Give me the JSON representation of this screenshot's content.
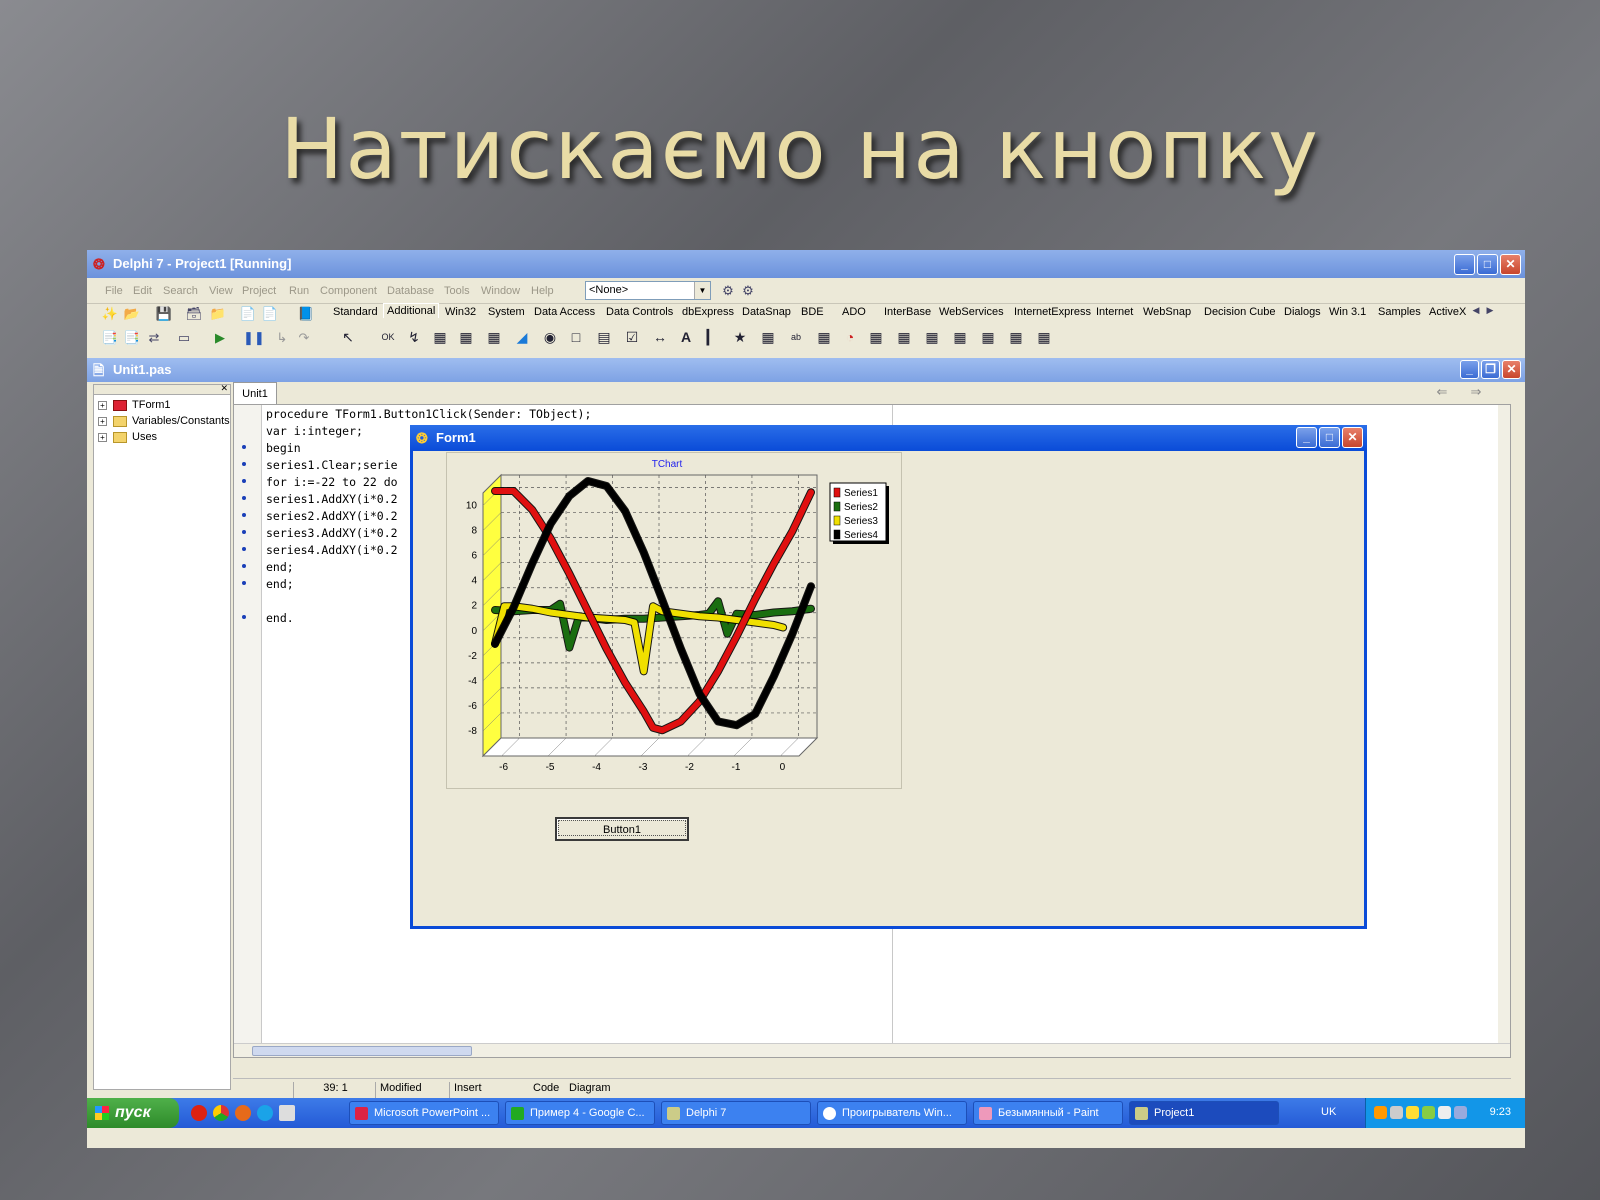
{
  "slide": {
    "title": "Натискаємо на кнопку"
  },
  "ide": {
    "title": "Delphi 7 - Project1 [Running]",
    "menu": [
      "File",
      "Edit",
      "Search",
      "View",
      "Project",
      "Run",
      "Component",
      "Database",
      "Tools",
      "Window",
      "Help"
    ],
    "config_combo": "<None>",
    "palette_tabs": [
      "Standard",
      "Additional",
      "Win32",
      "System",
      "Data Access",
      "Data Controls",
      "dbExpress",
      "DataSnap",
      "BDE",
      "ADO",
      "InterBase",
      "WebServices",
      "InternetExpress",
      "Internet",
      "WebSnap",
      "Decision Cube",
      "Dialogs",
      "Win 3.1",
      "Samples",
      "ActiveX"
    ],
    "active_palette_tab": "Additional"
  },
  "editor": {
    "title": "Unit1.pas",
    "tab": "Unit1",
    "tree": [
      "TForm1",
      "Variables/Constants",
      "Uses"
    ],
    "code": [
      "procedure TForm1.Button1Click(Sender: TObject);",
      "var i:integer;",
      "begin",
      "series1.Clear;serie",
      "for i:=-22 to 22 do",
      "series1.AddXY(i*0.2",
      "series2.AddXY(i*0.2",
      "series3.AddXY(i*0.2",
      "series4.AddXY(i*0.2",
      "end;",
      "end;",
      "",
      "end."
    ],
    "status": {
      "position": "39: 1",
      "modified": "Modified",
      "mode": "Insert",
      "tab_code": "Code",
      "tab_diagram": "Diagram"
    }
  },
  "form1": {
    "title": "Form1",
    "button_label": "Button1"
  },
  "chart_data": {
    "type": "line",
    "title": "TChart",
    "xlabel": "",
    "ylabel": "",
    "xlim": [
      -6.4,
      0.4
    ],
    "ylim": [
      -10,
      11
    ],
    "xticks": [
      "-6",
      "-5",
      "-4",
      "-3",
      "-2",
      "-1",
      "0"
    ],
    "yticks": [
      "10",
      "8",
      "6",
      "4",
      "2",
      "0",
      "-2",
      "-4",
      "-6",
      "-8"
    ],
    "legend_position": "right",
    "grid": true,
    "series": [
      {
        "name": "Series1",
        "color": "#e01010",
        "x": [
          -6.4,
          -6,
          -5.6,
          -5.2,
          -4.8,
          -4.4,
          -4,
          -3.6,
          -3.2,
          -3,
          -2.8,
          -2.4,
          -2,
          -1.6,
          -1.2,
          -0.8,
          -0.4,
          0,
          0.4
        ],
        "y": [
          10.2,
          10.2,
          8.7,
          6.4,
          3.6,
          0.6,
          -2.4,
          -5.1,
          -7.4,
          -8.7,
          -8.9,
          -8.2,
          -6.6,
          -4.2,
          -1.4,
          1.6,
          4.4,
          7.0,
          10.1
        ]
      },
      {
        "name": "Series2",
        "color": "#1a6e10",
        "x": [
          -6.4,
          -6,
          -5.6,
          -5.2,
          -5,
          -4.8,
          -4.6,
          -4.4,
          -4,
          -3.6,
          -3.2,
          -2.8,
          -2.4,
          -2,
          -1.8,
          -1.6,
          -1.4,
          -1.2,
          -0.8,
          -0.4,
          0,
          0.4
        ],
        "y": [
          0.7,
          0.6,
          0.7,
          0.7,
          1.2,
          -2.3,
          0.1,
          0.1,
          -0.1,
          0,
          0,
          0.1,
          0.2,
          0.3,
          0.4,
          1.4,
          -1.2,
          0.4,
          0.3,
          0.5,
          0.6,
          0.8
        ]
      },
      {
        "name": "Series3",
        "color": "#f0e000",
        "x": [
          -6.4,
          -6.2,
          -6,
          -5.6,
          -5.2,
          -4.8,
          -4.4,
          -4,
          -3.6,
          -3.4,
          -3.2,
          -3,
          -2.8,
          -2.4,
          -2,
          -1.6,
          -1.2,
          -0.8,
          -0.4,
          -0.2
        ],
        "y": [
          -2,
          1,
          1,
          0.8,
          0.5,
          0.3,
          0.1,
          0,
          -0.1,
          -0.3,
          -4.2,
          1,
          0.6,
          0.4,
          0.2,
          0.1,
          -0.1,
          -0.3,
          -0.5,
          -0.7
        ]
      },
      {
        "name": "Series4",
        "color": "#000000",
        "x": [
          -6.4,
          -6,
          -5.6,
          -5.2,
          -4.8,
          -4.4,
          -4,
          -3.6,
          -3.2,
          -2.8,
          -2.4,
          -2,
          -1.6,
          -1.2,
          -0.8,
          -0.4,
          0,
          0.4
        ],
        "y": [
          -2,
          0.9,
          4.4,
          7.6,
          9.8,
          11,
          10.6,
          8.6,
          5.3,
          1.5,
          -2.4,
          -6,
          -8.2,
          -8.5,
          -7.6,
          -4.6,
          -1.2,
          2.6
        ]
      }
    ]
  },
  "taskbar": {
    "start": "пуск",
    "tasks": [
      "Microsoft PowerPoint ...",
      "Пример 4 - Google C...",
      "Delphi 7",
      "Проигрыватель Win...",
      "Безымянный - Paint",
      "Project1"
    ],
    "active_task": "Project1",
    "lang": "UK",
    "clock": "9:23"
  }
}
